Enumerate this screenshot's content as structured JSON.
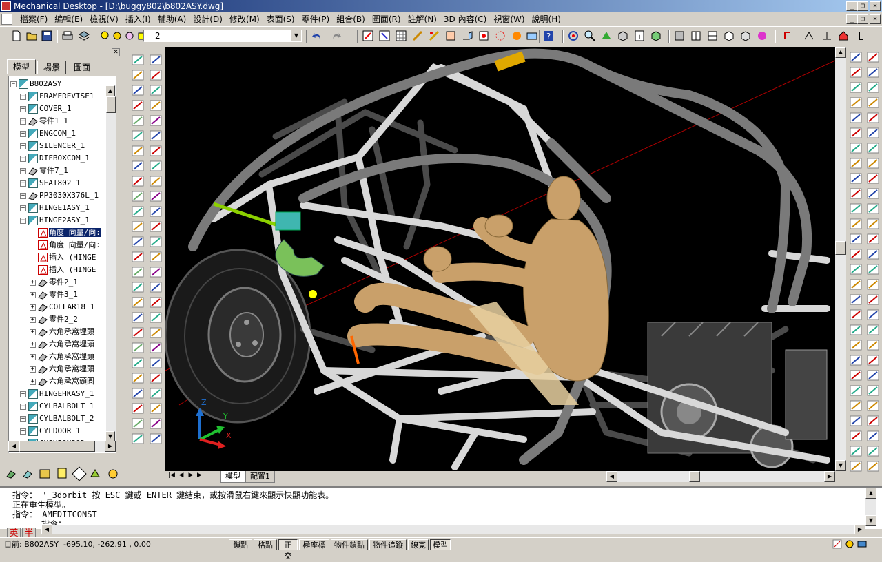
{
  "window": {
    "title": "Mechanical Desktop - [D:\\buggy802\\b802ASY.dwg]",
    "controls": {
      "minimize": "_",
      "restore": "❐",
      "close": "✕"
    }
  },
  "menu": [
    "檔案(F)",
    "編輯(E)",
    "檢視(V)",
    "插入(I)",
    "輔助(A)",
    "設計(D)",
    "修改(M)",
    "表面(S)",
    "零件(P)",
    "組合(B)",
    "圖面(R)",
    "註解(N)",
    "3D 內容(C)",
    "視窗(W)",
    "說明(H)"
  ],
  "toolbar": {
    "layer_value": "2"
  },
  "browser": {
    "tabs": [
      "模型",
      "場景",
      "圖面"
    ],
    "tree": [
      {
        "label": "B802ASY",
        "level": 0,
        "exp": "−",
        "icon": "asm"
      },
      {
        "label": "FRAMEREVISE1",
        "level": 1,
        "exp": "+",
        "icon": "asm"
      },
      {
        "label": "COVER_1",
        "level": 1,
        "exp": "+",
        "icon": "asm"
      },
      {
        "label": "零件1_1",
        "level": 1,
        "exp": "+",
        "icon": "part"
      },
      {
        "label": "ENGCOM_1",
        "level": 1,
        "exp": "+",
        "icon": "asm"
      },
      {
        "label": "SILENCER_1",
        "level": 1,
        "exp": "+",
        "icon": "asm"
      },
      {
        "label": "DIFBOXCOM_1",
        "level": 1,
        "exp": "+",
        "icon": "asm"
      },
      {
        "label": "零件7_1",
        "level": 1,
        "exp": "+",
        "icon": "part"
      },
      {
        "label": "SEAT802_1",
        "level": 1,
        "exp": "+",
        "icon": "asm"
      },
      {
        "label": "PP3030X376L_1",
        "level": 1,
        "exp": "+",
        "icon": "part"
      },
      {
        "label": "HINGE1ASY_1",
        "level": 1,
        "exp": "+",
        "icon": "asm"
      },
      {
        "label": "HINGE2ASY_1",
        "level": 1,
        "exp": "−",
        "icon": "asm"
      },
      {
        "label": "角度 向量/向:",
        "level": 2,
        "exp": "",
        "icon": "cons",
        "selected": true
      },
      {
        "label": "角度 向量/向:",
        "level": 2,
        "exp": "",
        "icon": "cons"
      },
      {
        "label": "插入 (HINGE",
        "level": 2,
        "exp": "",
        "icon": "cons"
      },
      {
        "label": "插入 (HINGE",
        "level": 2,
        "exp": "",
        "icon": "cons"
      },
      {
        "label": "零件2_1",
        "level": 2,
        "exp": "+",
        "icon": "part"
      },
      {
        "label": "零件3_1",
        "level": 2,
        "exp": "+",
        "icon": "part"
      },
      {
        "label": "COLLAR18_1",
        "level": 2,
        "exp": "+",
        "icon": "part"
      },
      {
        "label": "零件2_2",
        "level": 2,
        "exp": "+",
        "icon": "part"
      },
      {
        "label": "六角承窩埋頭",
        "level": 2,
        "exp": "+",
        "icon": "part"
      },
      {
        "label": "六角承窩埋頭",
        "level": 2,
        "exp": "+",
        "icon": "part"
      },
      {
        "label": "六角承窩埋頭",
        "level": 2,
        "exp": "+",
        "icon": "part"
      },
      {
        "label": "六角承窩埋頭",
        "level": 2,
        "exp": "+",
        "icon": "part"
      },
      {
        "label": "六角承窩頭圓",
        "level": 2,
        "exp": "+",
        "icon": "part"
      },
      {
        "label": "HINGEHKASY_1",
        "level": 1,
        "exp": "+",
        "icon": "asm"
      },
      {
        "label": "CYLBALBOLT_1",
        "level": 1,
        "exp": "+",
        "icon": "asm"
      },
      {
        "label": "CYLBALBOLT_2",
        "level": 1,
        "exp": "+",
        "icon": "asm"
      },
      {
        "label": "CYLDOOR_1",
        "level": 1,
        "exp": "+",
        "icon": "asm"
      },
      {
        "label": "CUSHIONROD",
        "level": 1,
        "exp": "+",
        "icon": "asm"
      }
    ]
  },
  "viewport": {
    "layout_tabs": [
      "模型",
      "配置1"
    ],
    "ucs": {
      "x": "X",
      "y": "Y",
      "z": "Z"
    }
  },
  "command": {
    "lines": [
      "指令： '_3dorbit 按 ESC 鍵或 ENTER 鍵結束，或按滑鼠右鍵來顯示快顯功能表。",
      "正在重生模型。",
      "指令： AMEDITCONST",
      "指令："
    ]
  },
  "ime": [
    "英",
    "半"
  ],
  "status": {
    "label": "目前: B802ASY",
    "coords": "-695.10, -262.91 , 0.00",
    "toggles": [
      {
        "label": "鎖點",
        "on": false
      },
      {
        "label": "格點",
        "on": false
      },
      {
        "label": "正交",
        "on": true
      },
      {
        "label": "極座標",
        "on": false
      },
      {
        "label": "物件鎖點",
        "on": false
      },
      {
        "label": "物件追蹤",
        "on": false
      },
      {
        "label": "線寬",
        "on": false
      },
      {
        "label": "模型",
        "on": true
      }
    ]
  },
  "colors": {
    "titlebar": "#0a246a",
    "viewport_bg": "#000000",
    "frame_tube": "#d8d8d8",
    "mannequin": "#c9a06a",
    "accent_yellow": "#e0a800",
    "hinge_green": "#7ac15a",
    "hinge_teal": "#3fb6b0"
  }
}
